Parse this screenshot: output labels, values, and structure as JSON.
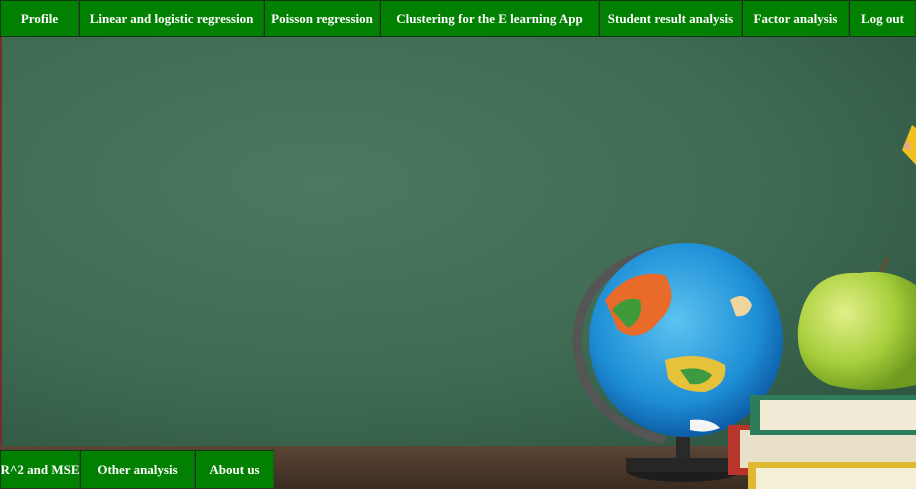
{
  "top_nav": {
    "items": [
      {
        "label": "Profile"
      },
      {
        "label": "Linear and logistic regression"
      },
      {
        "label": "Poisson regression"
      },
      {
        "label": "Clustering for the E learning App"
      },
      {
        "label": "Student result analysis"
      },
      {
        "label": "Factor analysis"
      },
      {
        "label": "Log out"
      }
    ]
  },
  "bottom_nav": {
    "items": [
      {
        "label": "R^2 and MSE"
      },
      {
        "label": "Other analysis"
      },
      {
        "label": "About us"
      }
    ]
  },
  "colors": {
    "nav_bg": "#018001",
    "nav_text": "#ffffff",
    "chalkboard": "#3d6a50"
  }
}
